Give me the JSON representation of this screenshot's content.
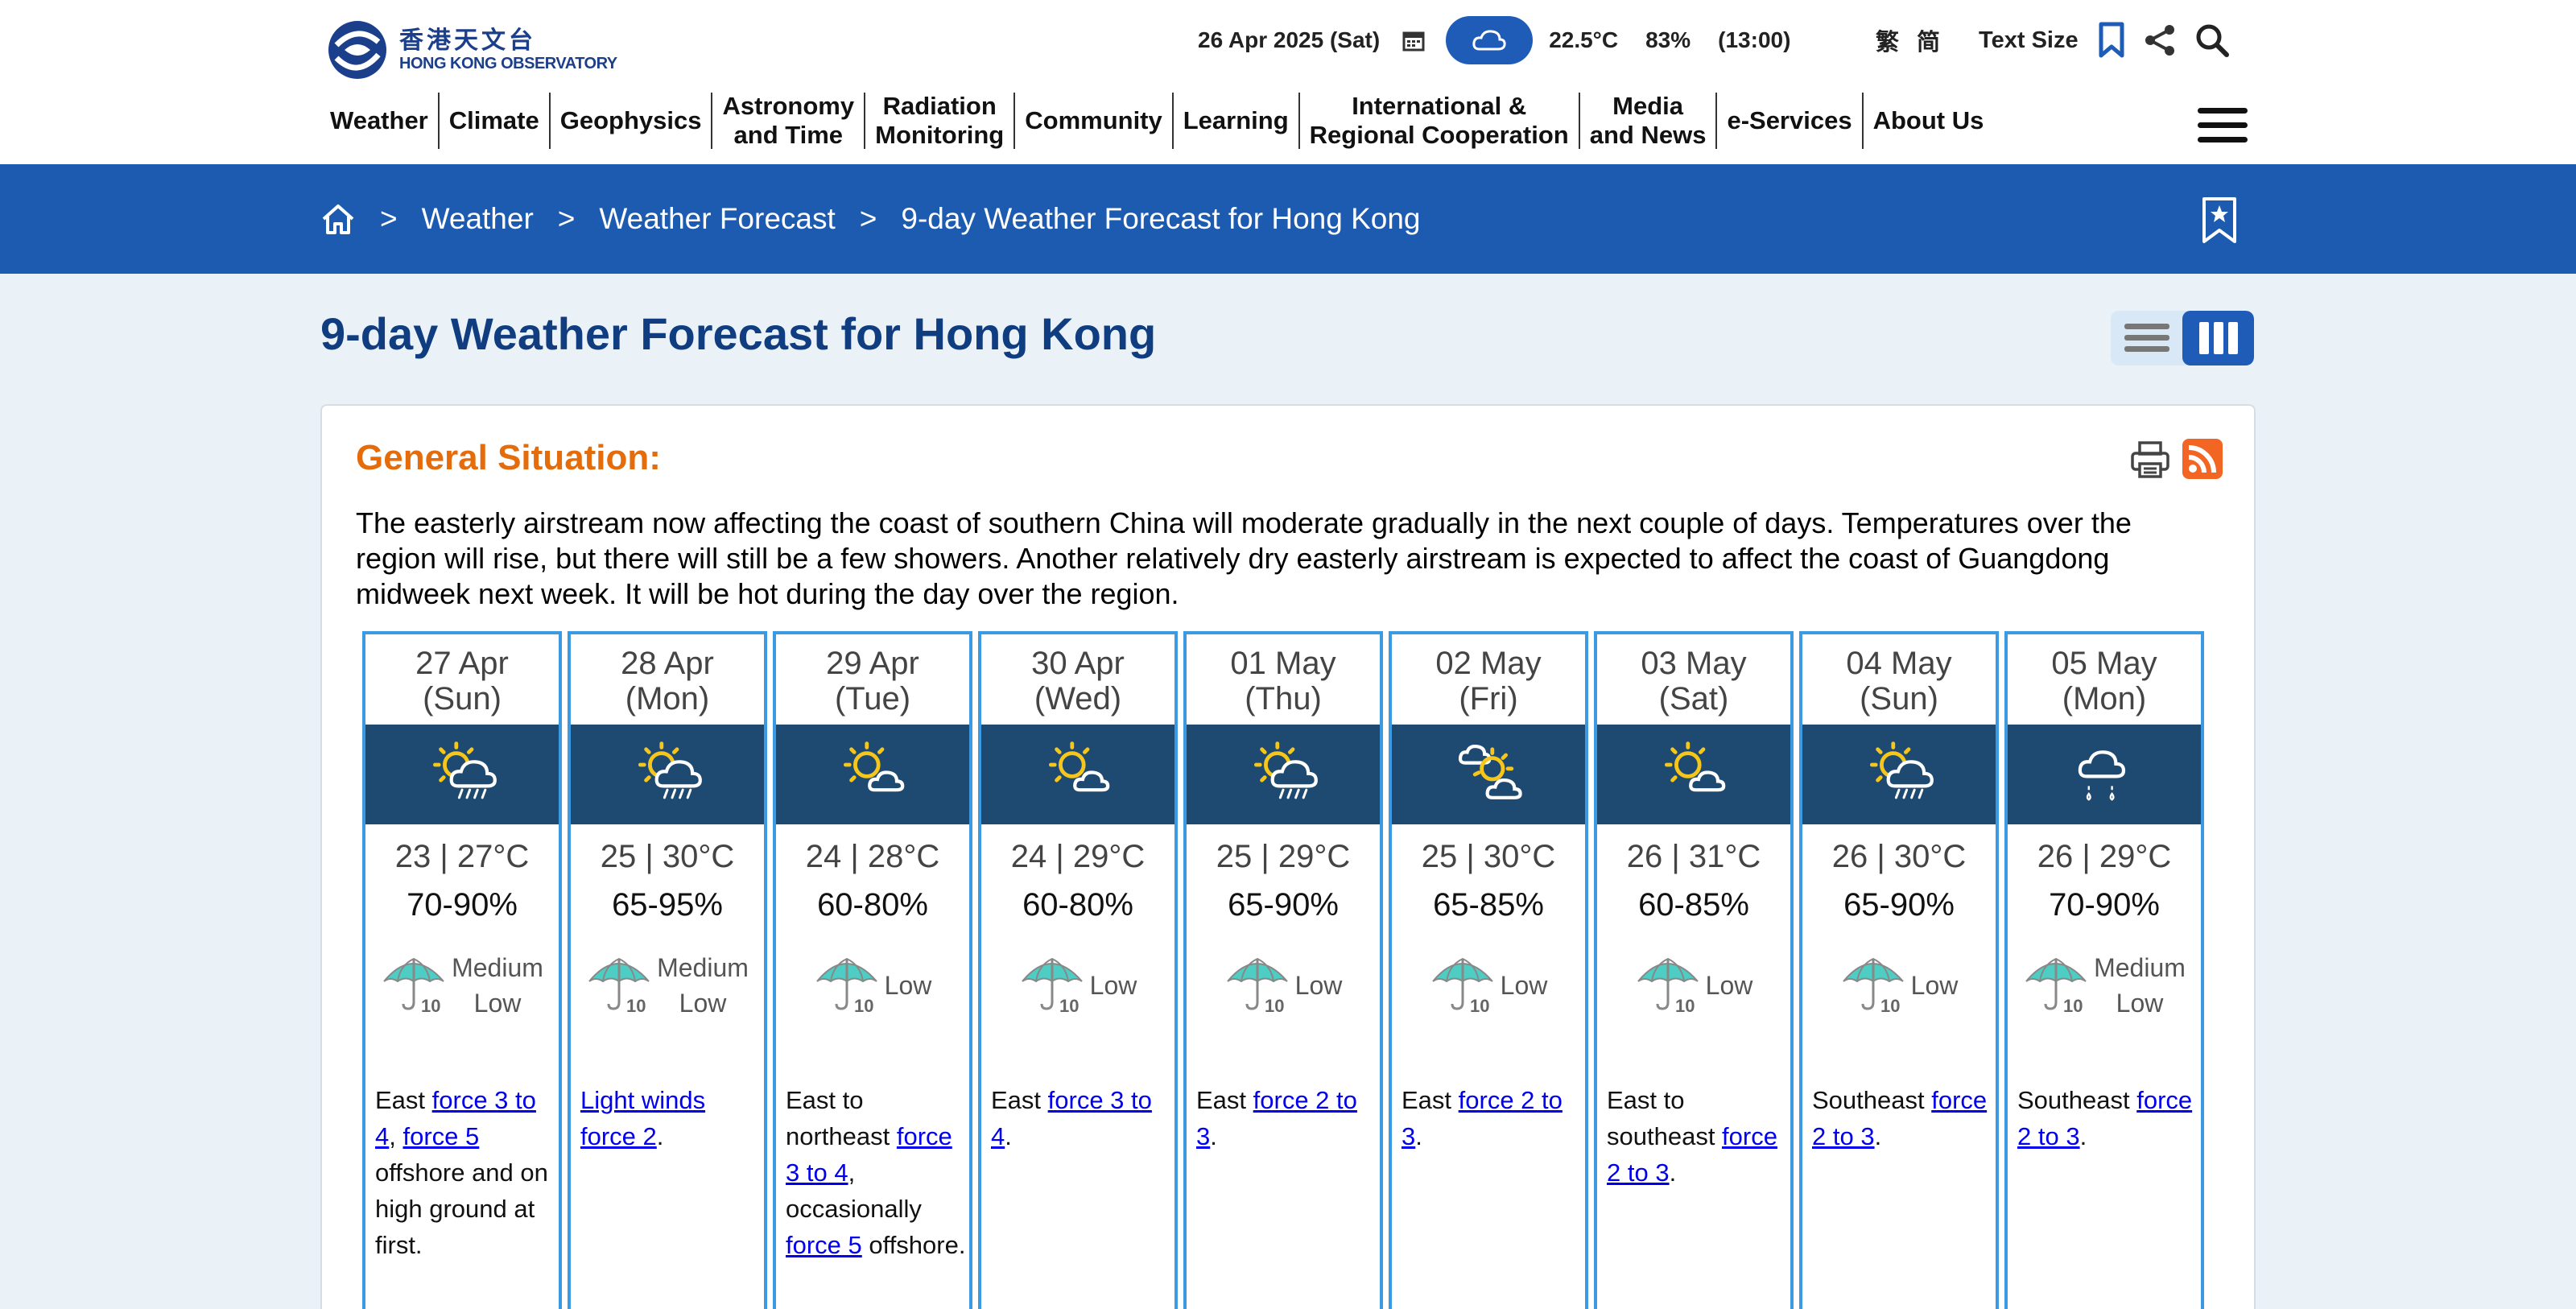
{
  "header": {
    "logo": {
      "cn": "香港天文台",
      "en": "HONG KONG OBSERVATORY"
    },
    "status": {
      "date": "26 Apr 2025 (Sat)",
      "weather_icon": "cloud-icon",
      "temperature": "22.5°C",
      "humidity": "83%",
      "time": "(13:00)"
    },
    "tools": {
      "trad_chinese": "繁",
      "simp_chinese": "简",
      "text_size": "Text Size"
    },
    "nav": [
      {
        "label": "Weather"
      },
      {
        "label": "Climate"
      },
      {
        "label": "Geophysics"
      },
      {
        "label": "Astronomy and Time",
        "line1": "Astronomy",
        "line2": "and Time"
      },
      {
        "label": "Radiation Monitoring",
        "line1": "Radiation",
        "line2": "Monitoring"
      },
      {
        "label": "Community"
      },
      {
        "label": "Learning"
      },
      {
        "label": "International & Regional Cooperation",
        "line1": "International &",
        "line2": "Regional Cooperation"
      },
      {
        "label": "Media and News",
        "line1": "Media",
        "line2": "and News"
      },
      {
        "label": "e-Services"
      },
      {
        "label": "About Us"
      }
    ]
  },
  "breadcrumb": {
    "items": [
      "Weather",
      "Weather Forecast",
      "9-day Weather Forecast for Hong Kong"
    ],
    "separator": ">"
  },
  "page": {
    "title": "9-day Weather Forecast for Hong Kong",
    "general_situation_title": "General Situation:",
    "general_situation_text": "The easterly airstream now affecting the coast of southern China will moderate gradually in the next couple of days. Temperatures over the region will rise, but there will still be a few showers. Another relatively dry easterly airstream is expected to affect the coast of Guangdong midweek next week. It will be hot during the day over the region."
  },
  "colors": {
    "brand_blue": "#1c5bb0",
    "title_blue": "#0f3d80",
    "orange": "#e46c0a",
    "column_border": "#3b9ae1",
    "icon_band": "#1e4a72"
  },
  "psr_icon_label": "10",
  "forecast": [
    {
      "date": "27 Apr",
      "weekday": "(Sun)",
      "icon": "sun-cloud-rain-icon",
      "temp": "23 | 27°C",
      "rh": "70-90%",
      "psr_line1": "Medium",
      "psr_line2": "Low",
      "wind": [
        {
          "t": "East "
        },
        {
          "a": "force 3 to 4"
        },
        {
          "t": ", "
        },
        {
          "a": "force 5"
        },
        {
          "t": " offshore and on high ground at first."
        }
      ]
    },
    {
      "date": "28 Apr",
      "weekday": "(Mon)",
      "icon": "sun-cloud-rain-icon",
      "temp": "25 | 30°C",
      "rh": "65-95%",
      "psr_line1": "Medium",
      "psr_line2": "Low",
      "wind": [
        {
          "a": "Light winds force 2"
        },
        {
          "t": "."
        }
      ]
    },
    {
      "date": "29 Apr",
      "weekday": "(Tue)",
      "icon": "sun-cloud-icon",
      "temp": "24 | 28°C",
      "rh": "60-80%",
      "psr_line1": "Low",
      "psr_line2": "",
      "wind": [
        {
          "t": "East to northeast "
        },
        {
          "a": "force 3 to 4"
        },
        {
          "t": ", occasionally "
        },
        {
          "a": "force 5"
        },
        {
          "t": " offshore."
        }
      ]
    },
    {
      "date": "30 Apr",
      "weekday": "(Wed)",
      "icon": "sun-cloud-icon",
      "temp": "24 | 29°C",
      "rh": "60-80%",
      "psr_line1": "Low",
      "psr_line2": "",
      "wind": [
        {
          "t": "East "
        },
        {
          "a": "force 3 to 4"
        },
        {
          "t": "."
        }
      ]
    },
    {
      "date": "01 May",
      "weekday": "(Thu)",
      "icon": "sun-cloud-rain-icon",
      "temp": "25 | 29°C",
      "rh": "65-90%",
      "psr_line1": "Low",
      "psr_line2": "",
      "wind": [
        {
          "t": "East "
        },
        {
          "a": "force 2 to 3"
        },
        {
          "t": "."
        }
      ]
    },
    {
      "date": "02 May",
      "weekday": "(Fri)",
      "icon": "cloud-sun-cloud-icon",
      "temp": "25 | 30°C",
      "rh": "65-85%",
      "psr_line1": "Low",
      "psr_line2": "",
      "wind": [
        {
          "t": "East "
        },
        {
          "a": "force 2 to 3"
        },
        {
          "t": "."
        }
      ]
    },
    {
      "date": "03 May",
      "weekday": "(Sat)",
      "icon": "sun-cloud-icon",
      "temp": "26 | 31°C",
      "rh": "60-85%",
      "psr_line1": "Low",
      "psr_line2": "",
      "wind": [
        {
          "t": "East to southeast "
        },
        {
          "a": "force 2 to 3"
        },
        {
          "t": "."
        }
      ]
    },
    {
      "date": "04 May",
      "weekday": "(Sun)",
      "icon": "sun-cloud-rain-icon",
      "temp": "26 | 30°C",
      "rh": "65-90%",
      "psr_line1": "Low",
      "psr_line2": "",
      "wind": [
        {
          "t": "Southeast "
        },
        {
          "a": "force 2 to 3"
        },
        {
          "t": "."
        }
      ]
    },
    {
      "date": "05 May",
      "weekday": "(Mon)",
      "icon": "cloud-rain-icon",
      "temp": "26 | 29°C",
      "rh": "70-90%",
      "psr_line1": "Medium",
      "psr_line2": "Low",
      "wind": [
        {
          "t": "Southeast "
        },
        {
          "a": "force 2 to 3"
        },
        {
          "t": "."
        }
      ]
    }
  ]
}
